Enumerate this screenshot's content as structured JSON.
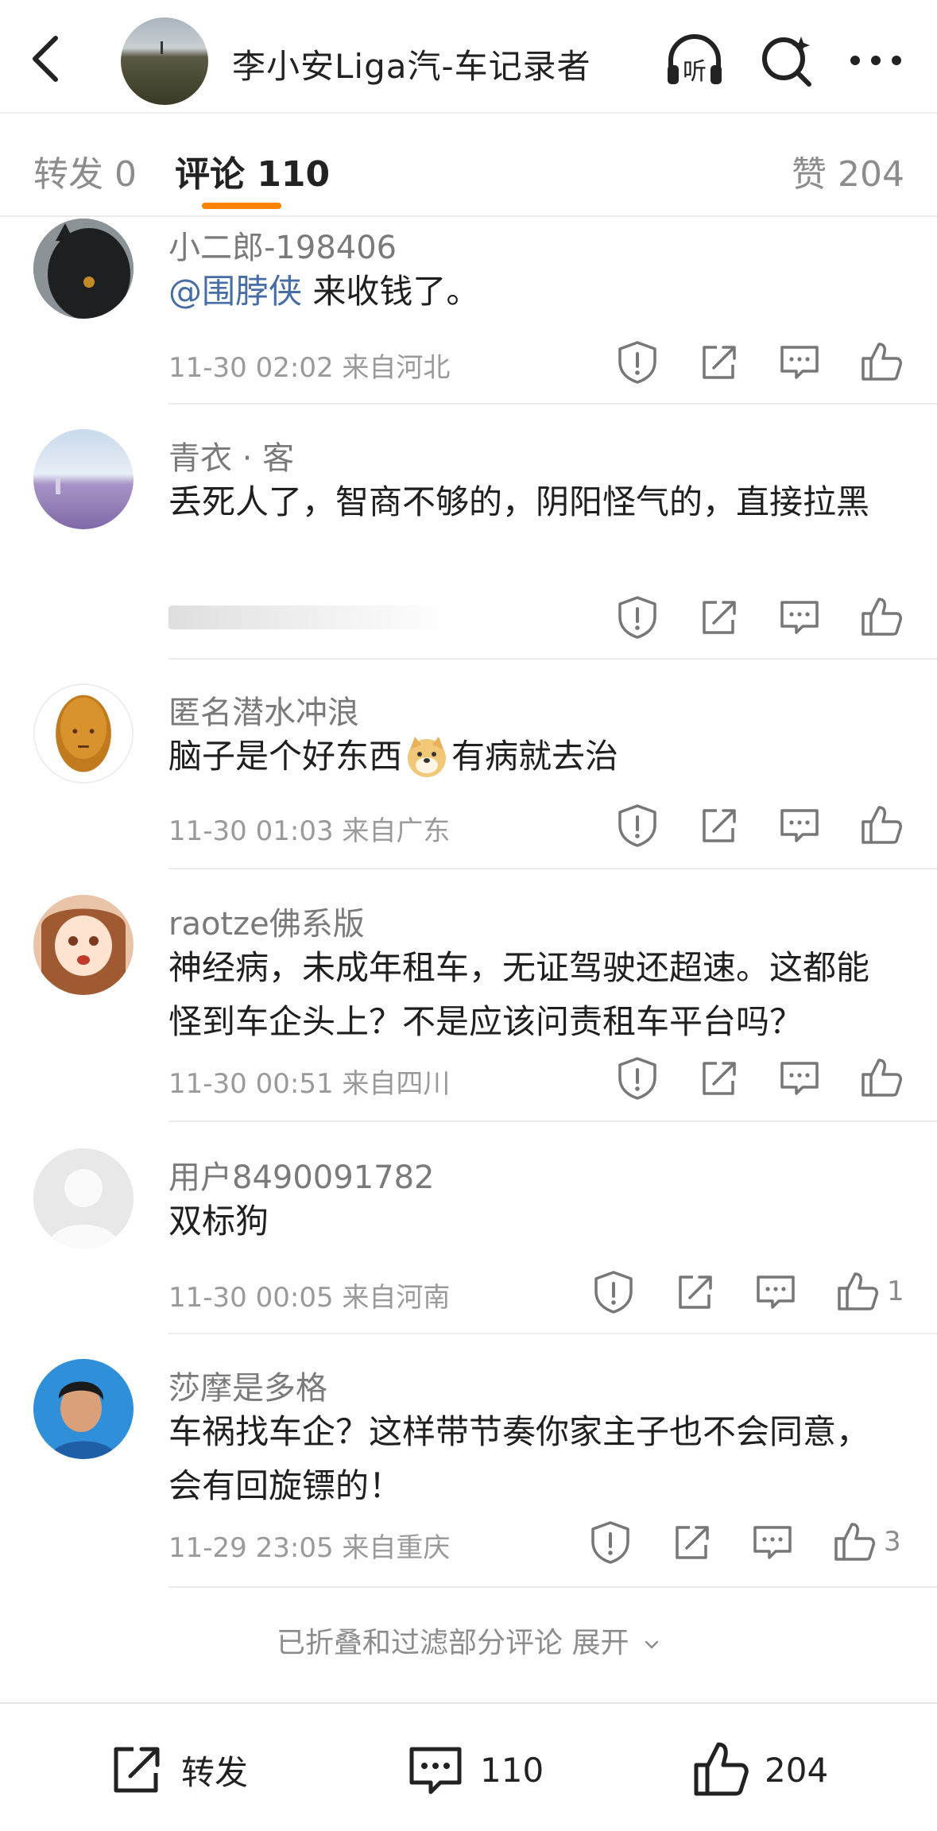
{
  "header": {
    "title": "李小安Liga汽-车记录者"
  },
  "tabs": {
    "repost": "转发 0",
    "comments": "评论 110",
    "likes": "赞 204"
  },
  "comments": [
    {
      "user": "小二郎-198406",
      "mention": "@围脖侠",
      "text": " 来收钱了。",
      "meta": "11-30 02:02 来自河北",
      "likes": ""
    },
    {
      "user": "青衣 · 客",
      "text": "丢死人了，智商不够的，阴阳怪气的，直接拉黑",
      "meta": "",
      "likes": ""
    },
    {
      "user": "匿名潜水冲浪",
      "text_a": "脑子是个好东西",
      "text_b": "有病就去治",
      "meta": "11-30 01:03 来自广东",
      "likes": ""
    },
    {
      "user": "raotze佛系版",
      "text": "神经病，未成年租车，无证驾驶还超速。这都能怪到车企头上？不是应该问责租车平台吗？",
      "meta": "11-30 00:51 来自四川",
      "likes": ""
    },
    {
      "user": "用户8490091782",
      "text": "双标狗",
      "meta": "11-30 00:05 来自河南",
      "likes": "1"
    },
    {
      "user": "莎摩是多格",
      "text": "车祸找车企？这样带节奏你家主子也不会同意，会有回旋镖的！",
      "meta": "11-29 23:05 来自重庆",
      "likes": "3"
    }
  ],
  "fold": {
    "text": "已折叠和过滤部分评论",
    "action": "展开"
  },
  "bottom": {
    "repost": "转发",
    "comments": "110",
    "likes": "204"
  },
  "icons": {
    "back": "back-arrow-icon",
    "listen": "headphones-icon",
    "search": "search-icon",
    "more": "more-icon",
    "report": "report-icon",
    "share": "share-icon",
    "reply": "reply-icon",
    "like": "thumb-up-icon"
  },
  "colors": {
    "accent": "#ff8200",
    "mention": "#476da6"
  }
}
